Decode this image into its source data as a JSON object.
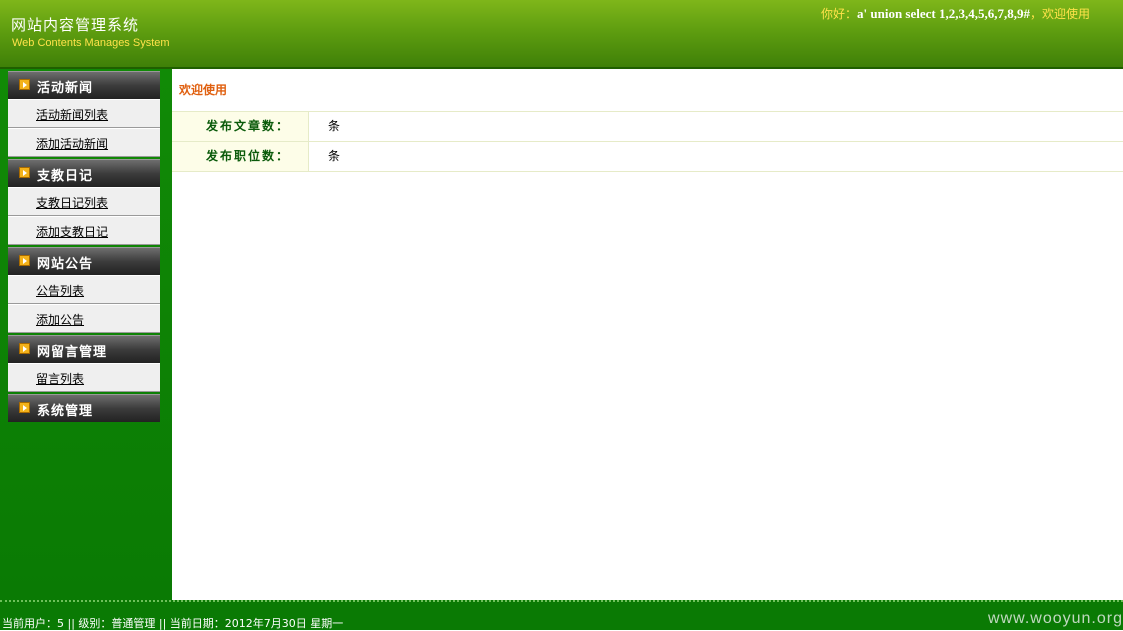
{
  "header": {
    "title": "网站内容管理系统",
    "subtitle": "Web Contents Manages System",
    "greeting_prefix": "你好：",
    "user": "a' union select 1,2,3,4,5,6,7,8,9#",
    "greeting_suffix": "，欢迎使用"
  },
  "sidebar": {
    "sections": [
      {
        "title": "活动新闻",
        "items": [
          "活动新闻列表",
          "添加活动新闻"
        ]
      },
      {
        "title": "支教日记",
        "items": [
          "支教日记列表",
          "添加支教日记"
        ]
      },
      {
        "title": "网站公告",
        "items": [
          "公告列表",
          "添加公告"
        ]
      },
      {
        "title": "网留言管理",
        "items": [
          "留言列表"
        ]
      },
      {
        "title": "系统管理",
        "items": []
      }
    ]
  },
  "main": {
    "title": "欢迎使用",
    "stats": [
      {
        "label": "发布文章数：",
        "value": "条"
      },
      {
        "label": "发布职位数：",
        "value": "条"
      }
    ]
  },
  "footer": {
    "status": "当前用户：5 || 级别：普通管理 || 当前日期：2012年7月30日 星期一",
    "watermark": "www.wooyun.org"
  }
}
